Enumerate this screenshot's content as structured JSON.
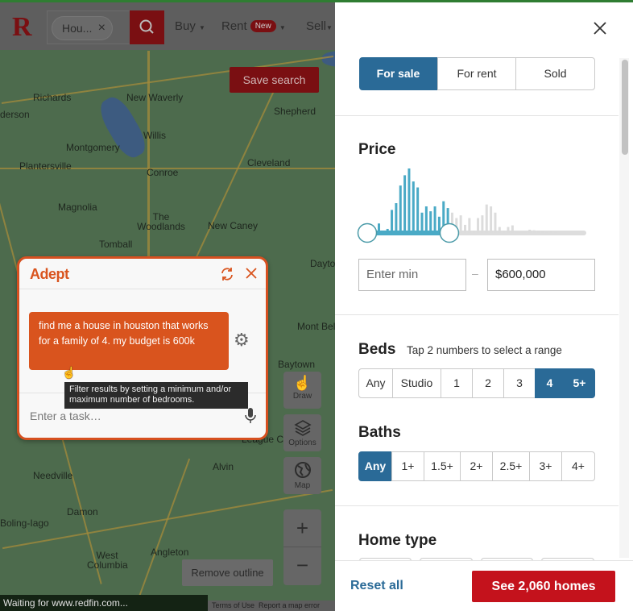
{
  "header": {
    "logo": "R",
    "search_chip": "Hou...",
    "chip_clear": "×",
    "nav": [
      "Buy",
      "Rent",
      "Sell"
    ],
    "new_badge": "New"
  },
  "map": {
    "save_search": "Save search",
    "labels": [
      "Richards",
      "New Waverly",
      "Shepherd",
      "derson",
      "Willis",
      "Montgomery",
      "Plantersville",
      "Conroe",
      "Cleveland",
      "Magnolia",
      "The Woodlands",
      "New Caney",
      "Tomball",
      "Mont Bel",
      "Baytown",
      "League Ci",
      "Alvin",
      "Needville",
      "Damon",
      "Boling-Iago",
      "West Columbia",
      "Angleton",
      "Dayto"
    ],
    "controls": {
      "draw": "Draw",
      "options": "Options",
      "map": "Map",
      "zoom_in": "+",
      "zoom_out": "−"
    },
    "remove_outline": "Remove outline",
    "footer": [
      "Terms of Use",
      "Report a map error"
    ]
  },
  "status_bar": "Waiting for www.redfin.com...",
  "adept": {
    "title": "Adept",
    "message": "find me a house in houston that works for a family of 4. my budget is 600k",
    "tooltip": "Filter results by setting a minimum and/or maximum number of bedrooms.",
    "input_placeholder": "Enter a task…",
    "accent": "#d9541e"
  },
  "filters": {
    "close": "×",
    "listing_types": [
      {
        "label": "For sale",
        "selected": true
      },
      {
        "label": "For rent",
        "selected": false
      },
      {
        "label": "Sold",
        "selected": false
      }
    ],
    "price": {
      "title": "Price",
      "min_placeholder": "Enter min",
      "max_value": "$600,000",
      "separator": "–",
      "histogram": [
        35,
        7,
        15,
        85,
        110,
        175,
        213,
        238,
        190,
        168,
        75,
        98,
        80,
        98,
        60,
        117,
        92,
        75,
        55,
        65,
        30,
        55,
        7,
        55,
        65,
        105,
        98,
        75,
        22,
        7,
        22,
        28,
        4,
        4,
        4,
        12,
        10,
        8,
        6,
        4,
        6,
        4
      ],
      "selected_bar_count": 17
    },
    "beds": {
      "title": "Beds",
      "hint": "Tap 2 numbers to select a range",
      "options": [
        "Any",
        "Studio",
        "1",
        "2",
        "3",
        "4",
        "5+"
      ],
      "selected": [
        "4",
        "5+"
      ]
    },
    "baths": {
      "title": "Baths",
      "options": [
        "Any",
        "1+",
        "1.5+",
        "2+",
        "2.5+",
        "3+",
        "4+"
      ],
      "selected": [
        "Any"
      ]
    },
    "home_type": {
      "title": "Home type"
    },
    "reset": "Reset all",
    "see_homes": "See 2,060 homes",
    "accent": "#2a6a97",
    "cta_color": "#c4121c"
  }
}
